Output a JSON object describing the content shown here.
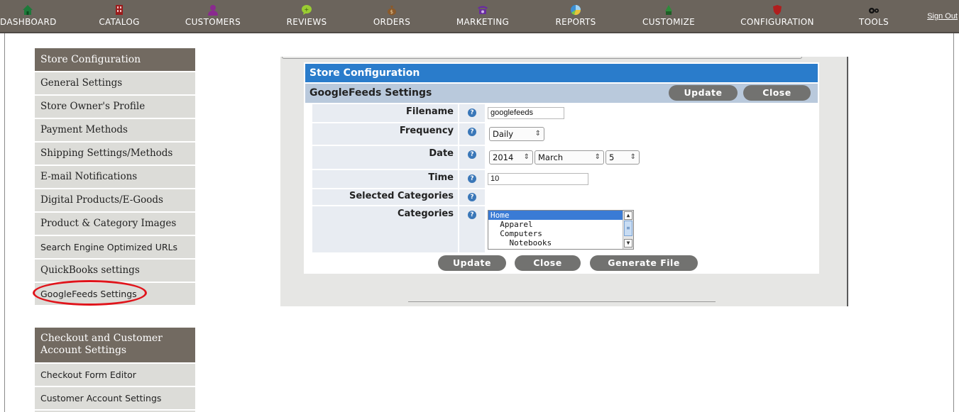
{
  "nav": {
    "items": [
      {
        "label": "DASHBOARD",
        "icon": "house-icon",
        "color": "#1d7a3a"
      },
      {
        "label": "CATALOG",
        "icon": "book-icon",
        "color": "#9b1c1c"
      },
      {
        "label": "CUSTOMERS",
        "icon": "person-icon",
        "color": "#8a2a8f"
      },
      {
        "label": "REVIEWS",
        "icon": "speech-bubble-icon",
        "color": "#9acd32"
      },
      {
        "label": "ORDERS",
        "icon": "money-bag-icon",
        "color": "#8b5a2b"
      },
      {
        "label": "MARKETING",
        "icon": "telephone-icon",
        "color": "#6a2ca0"
      },
      {
        "label": "REPORTS",
        "icon": "pie-chart-icon",
        "color": "#3b8fd4"
      },
      {
        "label": "CUSTOMIZE",
        "icon": "paint-icon",
        "color": "#2e8b3a"
      },
      {
        "label": "CONFIGURATION",
        "icon": "shield-icon",
        "color": "#b01e1e"
      },
      {
        "label": "TOOLS",
        "icon": "keys-icon",
        "color": "#111111"
      }
    ],
    "signout": "Sign Out"
  },
  "sidebar": {
    "store_config": {
      "heading": "Store Configuration",
      "items": [
        "General Settings",
        "Store Owner's Profile",
        "Payment Methods",
        "Shipping Settings/Methods",
        "E-mail Notifications",
        "Digital Products/E-Goods",
        "Product & Category Images",
        "Search Engine Optimized URLs",
        "QuickBooks settings",
        "GoogleFeeds Settings"
      ]
    },
    "checkout": {
      "heading": "Checkout and Customer Account Settings",
      "items": [
        "Checkout Form Editor",
        "Customer Account Settings"
      ]
    }
  },
  "panel": {
    "title": "Store Configuration",
    "subtitle": "GoogleFeeds Settings",
    "top_buttons": {
      "update": "Update",
      "close": "Close"
    },
    "fields": {
      "filename": {
        "label": "Filename",
        "value": "googlefeeds"
      },
      "frequency": {
        "label": "Frequency",
        "value": "Daily"
      },
      "date": {
        "label": "Date",
        "year": "2014",
        "month": "March",
        "day": "5"
      },
      "time": {
        "label": "Time",
        "value": "10"
      },
      "selected_categories": {
        "label": "Selected Categories"
      },
      "categories": {
        "label": "Categories",
        "options": [
          "Home",
          "  Apparel",
          "  Computers",
          "    Notebooks"
        ],
        "selected": "Home"
      }
    },
    "bottom_buttons": {
      "update": "Update",
      "close": "Close",
      "generate": "Generate File"
    }
  },
  "colors": {
    "nav_bg": "#6b645c",
    "sidebar_head": "#726a61",
    "sidebar_item": "#dcdcd8",
    "panel_title": "#2a7ccb",
    "panel_sub": "#b9c9dc",
    "button": "#727270",
    "highlight": "#e0141b"
  }
}
